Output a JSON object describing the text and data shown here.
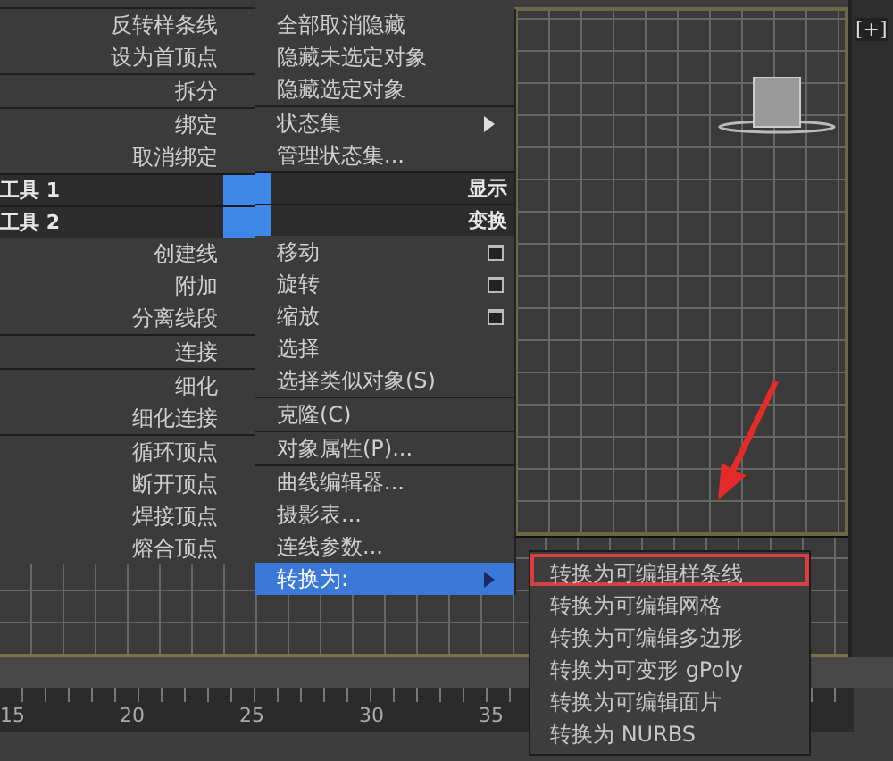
{
  "quad_menu": {
    "left": [
      {
        "kind": "separator"
      },
      {
        "kind": "item",
        "label": "反转样条线",
        "selected": false
      },
      {
        "kind": "item",
        "label": "设为首顶点",
        "selected": false
      },
      {
        "kind": "separator"
      },
      {
        "kind": "item",
        "label": "拆分",
        "selected": false
      },
      {
        "kind": "separator"
      },
      {
        "kind": "item",
        "label": "绑定",
        "selected": false
      },
      {
        "kind": "item",
        "label": "取消绑定",
        "selected": false
      },
      {
        "kind": "header",
        "label": "工具 1"
      },
      {
        "kind": "header",
        "label": "工具 2"
      },
      {
        "kind": "item",
        "label": "创建线",
        "selected": false
      },
      {
        "kind": "item",
        "label": "附加",
        "selected": false
      },
      {
        "kind": "item",
        "label": "分离线段",
        "selected": false
      },
      {
        "kind": "separator"
      },
      {
        "kind": "item",
        "label": "连接",
        "selected": false
      },
      {
        "kind": "separator"
      },
      {
        "kind": "item",
        "label": "细化",
        "selected": false
      },
      {
        "kind": "item",
        "label": "细化连接",
        "selected": false
      },
      {
        "kind": "separator"
      },
      {
        "kind": "item",
        "label": "循环顶点",
        "selected": false
      },
      {
        "kind": "item",
        "label": "断开顶点",
        "selected": false
      },
      {
        "kind": "item",
        "label": "焊接顶点",
        "selected": false
      },
      {
        "kind": "item",
        "label": "熔合顶点",
        "selected": false
      }
    ],
    "right": [
      {
        "kind": "item",
        "label": "全部取消隐藏",
        "selected": false,
        "option_box": false,
        "submenu": false
      },
      {
        "kind": "item",
        "label": "隐藏未选定对象",
        "selected": false,
        "option_box": false,
        "submenu": false
      },
      {
        "kind": "item",
        "label": "隐藏选定对象",
        "selected": false,
        "option_box": false,
        "submenu": false
      },
      {
        "kind": "separator"
      },
      {
        "kind": "item",
        "label": "状态集",
        "selected": false,
        "option_box": false,
        "submenu": true
      },
      {
        "kind": "item",
        "label": "管理状态集...",
        "selected": false,
        "option_box": false,
        "submenu": false
      },
      {
        "kind": "header",
        "label": "显示"
      },
      {
        "kind": "header",
        "label": "变换"
      },
      {
        "kind": "item",
        "label": "移动",
        "selected": false,
        "option_box": true,
        "submenu": false
      },
      {
        "kind": "item",
        "label": "旋转",
        "selected": false,
        "option_box": true,
        "submenu": false
      },
      {
        "kind": "item",
        "label": "缩放",
        "selected": false,
        "option_box": true,
        "submenu": false
      },
      {
        "kind": "item",
        "label": "选择",
        "selected": false,
        "option_box": false,
        "submenu": false
      },
      {
        "kind": "item",
        "label": "选择类似对象(S)",
        "selected": false,
        "option_box": false,
        "submenu": false
      },
      {
        "kind": "separator"
      },
      {
        "kind": "item",
        "label": "克隆(C)",
        "selected": false,
        "option_box": false,
        "submenu": false
      },
      {
        "kind": "separator"
      },
      {
        "kind": "item",
        "label": "对象属性(P)...",
        "selected": false,
        "option_box": false,
        "submenu": false
      },
      {
        "kind": "separator"
      },
      {
        "kind": "item",
        "label": "曲线编辑器...",
        "selected": false,
        "option_box": false,
        "submenu": false
      },
      {
        "kind": "item",
        "label": "摄影表...",
        "selected": false,
        "option_box": false,
        "submenu": false
      },
      {
        "kind": "item",
        "label": "连线参数...",
        "selected": false,
        "option_box": false,
        "submenu": false
      },
      {
        "kind": "item",
        "label": "转换为:",
        "selected": true,
        "option_box": false,
        "submenu": true
      }
    ]
  },
  "submenu": [
    {
      "label": "转换为可编辑样条线",
      "highlighted": true
    },
    {
      "label": "转换为可编辑网格",
      "highlighted": false
    },
    {
      "label": "转换为可编辑多边形",
      "highlighted": false
    },
    {
      "label": "转换为可变形 gPoly",
      "highlighted": false
    },
    {
      "label": "转换为可编辑面片",
      "highlighted": false
    },
    {
      "label": "转换为 NURBS",
      "highlighted": false
    }
  ],
  "viewport": {
    "label": "[+]"
  },
  "timeline": {
    "ticks": [
      "15",
      "20",
      "25",
      "30",
      "35"
    ]
  }
}
